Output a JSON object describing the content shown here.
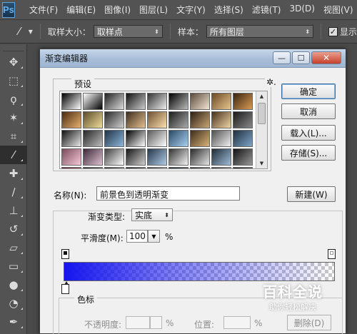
{
  "app": {
    "logo": "Ps"
  },
  "menu": {
    "items": [
      "文件(F)",
      "编辑(E)",
      "图像(I)",
      "图层(L)",
      "文字(Y)",
      "选择(S)",
      "滤镜(T)",
      "3D(D)",
      "视图(V)"
    ]
  },
  "options": {
    "sample_size_label": "取样大小：",
    "sample_size_value": "取样点",
    "sample_label": "样本：",
    "sample_value": "所有图层",
    "show_ring_label": "显示",
    "show_ring_checked": "✓"
  },
  "tools": [
    {
      "name": "move-tool",
      "glyph": "✥"
    },
    {
      "name": "marquee-tool",
      "glyph": "⬚"
    },
    {
      "name": "lasso-tool",
      "glyph": "ϙ"
    },
    {
      "name": "magic-wand-tool",
      "glyph": "✶"
    },
    {
      "name": "crop-tool",
      "glyph": "⌗"
    },
    {
      "name": "eyedropper-tool",
      "glyph": "⁄"
    },
    {
      "name": "healing-brush-tool",
      "glyph": "✚"
    },
    {
      "name": "brush-tool",
      "glyph": "∕"
    },
    {
      "name": "clone-stamp-tool",
      "glyph": "⊥"
    },
    {
      "name": "history-brush-tool",
      "glyph": "↺"
    },
    {
      "name": "eraser-tool",
      "glyph": "▱"
    },
    {
      "name": "gradient-tool",
      "glyph": "▭"
    },
    {
      "name": "blur-tool",
      "glyph": "●"
    },
    {
      "name": "dodge-tool",
      "glyph": "◔"
    },
    {
      "name": "pen-tool",
      "glyph": "✒"
    }
  ],
  "dialog": {
    "title": "渐变编辑器",
    "window_buttons": {
      "minimize": "—",
      "maximize": "☐",
      "close": "✕"
    },
    "presets_label": "预设",
    "gear_icon": "✲.",
    "presets": [
      [
        "#000000",
        "#ffffff"
      ],
      [
        "#ffffff",
        "#000000"
      ],
      [
        "#222222",
        "#dddddd"
      ],
      [
        "#111111",
        "#cccccc"
      ],
      [
        "#333333",
        "#eeeeee"
      ],
      [
        "#000000",
        "#bbbbbb"
      ],
      [
        "#5a4a3a",
        "#f3e6d3"
      ],
      [
        "#6b4a24",
        "#e7c48e"
      ],
      [
        "#3a2410",
        "#d79a54"
      ],
      [
        "#4a2a10",
        "#e6b070"
      ],
      [
        "#5b4b2a",
        "#f0dc9a"
      ],
      [
        "#2a2a2a",
        "#cfcfcf"
      ],
      [
        "#3d2c1c",
        "#e3c090"
      ],
      [
        "#705030",
        "#fce0b0"
      ],
      [
        "#1c1c1c",
        "#aaaaaa"
      ],
      [
        "#2b1f12",
        "#c9a577"
      ],
      [
        "#46321e",
        "#f1d4a4"
      ],
      [
        "#1a1a1a",
        "#888888"
      ],
      [
        "#101010",
        "#e8e8e8"
      ],
      [
        "#262626",
        "#bcbcbc"
      ],
      [
        "#1d3247",
        "#8fb6d9"
      ],
      [
        "#000000",
        "#ffffff"
      ],
      [
        "#5b5b5b",
        "#ffffff"
      ],
      [
        "#2b4966",
        "#a9d0f0"
      ],
      [
        "#3c2c1a",
        "#d9b27a"
      ],
      [
        "#505050",
        "#f0f0f0"
      ],
      [
        "#1f2f3f",
        "#7ea4c6"
      ],
      [
        "#7a4a5a",
        "#f5c8d8"
      ],
      [
        "#3a2a3a",
        "#e0c0d0"
      ],
      [
        "#404040",
        "#ffffff"
      ],
      [
        "#161616",
        "#d0d0d0"
      ],
      [
        "#24364a",
        "#b0cce6"
      ],
      [
        "#343434",
        "#f5f5f5"
      ],
      [
        "#2a2a2a",
        "#e6e6e6"
      ],
      [
        "#1e2c3a",
        "#a0bcd6"
      ],
      [
        "#111111",
        "#999999"
      ],
      [
        "#5a2030",
        "#d08090"
      ],
      [
        "#202020",
        "#c0c0c0"
      ],
      [
        "#303030",
        "#e0e0e0"
      ],
      [
        "#181818",
        "#b8b8b8"
      ],
      [
        "#444444",
        "#fafafa"
      ],
      [
        "#101820",
        "#8898a8"
      ],
      [
        "#282828",
        "#d8d8d8"
      ],
      [
        "#383838",
        "#eeeeee"
      ],
      [
        "#141414",
        "#a8a8a8"
      ]
    ],
    "buttons": {
      "ok": "确定",
      "cancel": "取消",
      "load": "载入(L)...",
      "save": "存储(S)...",
      "new": "新建(W)"
    },
    "name_label": "名称(N):",
    "name_value": "前景色到透明渐变",
    "gradient_type_label": "渐变类型:",
    "gradient_type_value": "实底",
    "smoothness_label": "平滑度(M):",
    "smoothness_value": "100",
    "percent": "%",
    "gradient_color": "#1515f0",
    "stops_section_label": "色标",
    "opacity_label": "不透明度:",
    "location_label": "位置:",
    "delete_label": "删除(D)"
  },
  "watermark": {
    "main": "百科全说",
    "sub": "助你轻松解决"
  }
}
